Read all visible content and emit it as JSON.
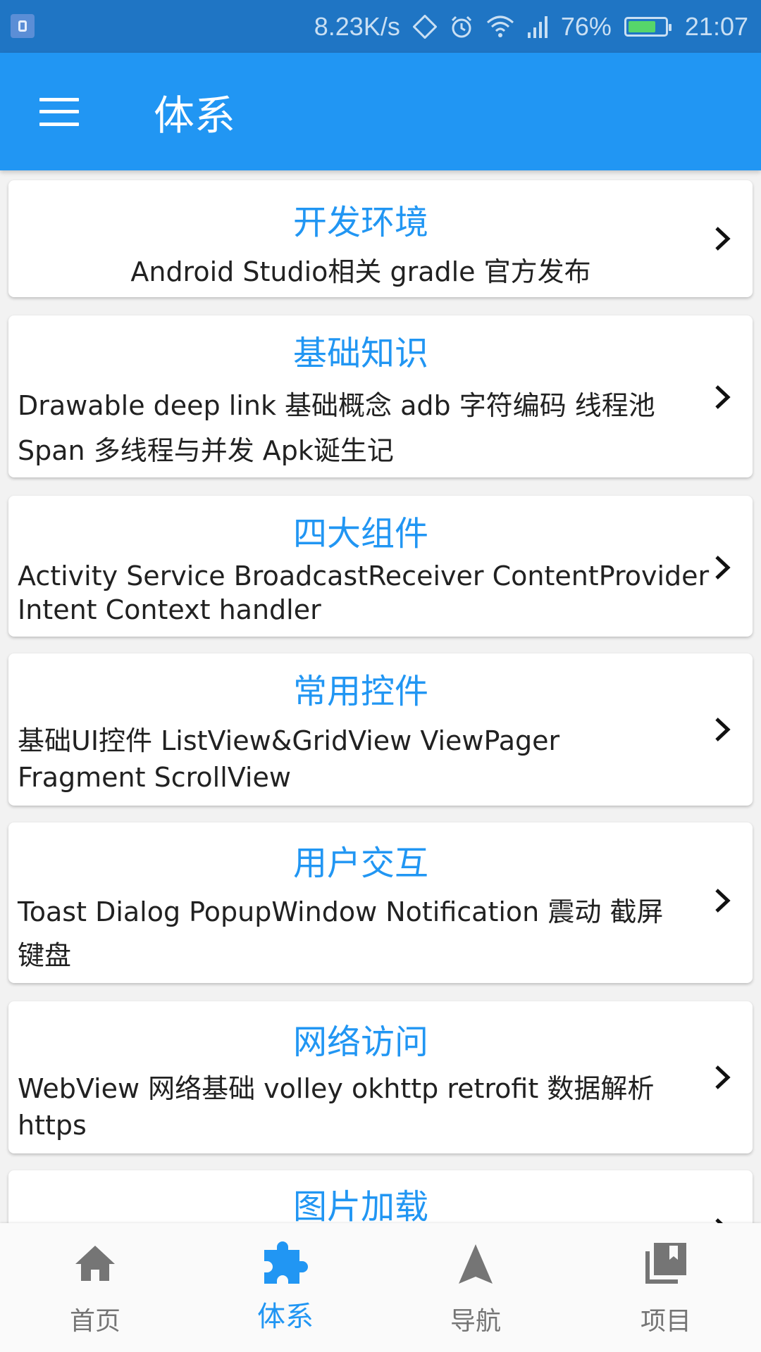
{
  "status_bar": {
    "speed": "8.23K/s",
    "battery_percent": "76%",
    "time": "21:07",
    "battery_level": 0.76
  },
  "app_bar": {
    "title": "体系"
  },
  "cards": [
    {
      "title": "开发环境",
      "desc": "Android Studio相关 gradle 官方发布"
    },
    {
      "title": "基础知识",
      "desc": "Drawable deep link 基础概念 adb 字符编码 线程池 Span 多线程与并发 Apk诞生记"
    },
    {
      "title": "四大组件",
      "desc": "Activity Service BroadcastReceiver ContentProvider Intent Context handler"
    },
    {
      "title": "常用控件",
      "desc": "基础UI控件 ListView&GridView ViewPager Fragment ScrollView"
    },
    {
      "title": "用户交互",
      "desc": "Toast Dialog PopupWindow Notification 震动 截屏 键盘"
    },
    {
      "title": "网络访问",
      "desc": "WebView 网络基础 volley okhttp retrofit 数据解析 https"
    },
    {
      "title": "图片加载",
      "desc": ""
    }
  ],
  "bottom_nav": {
    "items": [
      {
        "label": "首页",
        "icon": "home-icon"
      },
      {
        "label": "体系",
        "icon": "puzzle-icon",
        "active": true
      },
      {
        "label": "导航",
        "icon": "navigation-icon"
      },
      {
        "label": "项目",
        "icon": "library-icon"
      }
    ]
  },
  "colors": {
    "primary": "#2196f3",
    "status_bar": "#1f75c4",
    "battery": "#56d56a"
  }
}
